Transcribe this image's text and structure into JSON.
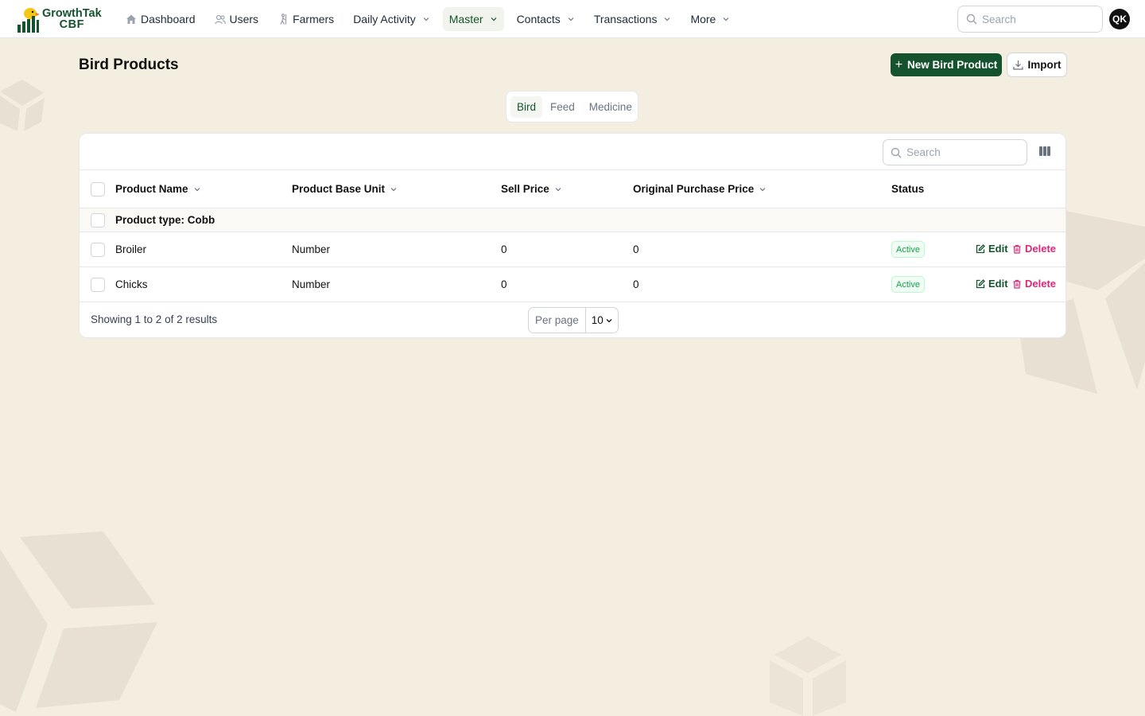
{
  "brand": {
    "name": "GrowthTak",
    "sub": "CBF"
  },
  "nav": {
    "items": [
      {
        "label": "Dashboard",
        "icon": "home-icon"
      },
      {
        "label": "Users",
        "icon": "users-icon"
      },
      {
        "label": "Farmers",
        "icon": "farmer-icon"
      },
      {
        "label": "Daily Activity",
        "dropdown": true
      },
      {
        "label": "Master",
        "dropdown": true,
        "active": true
      },
      {
        "label": "Contacts",
        "dropdown": true
      },
      {
        "label": "Transactions",
        "dropdown": true
      },
      {
        "label": "More",
        "dropdown": true
      }
    ],
    "search_placeholder": "Search",
    "avatar_initials": "QK"
  },
  "page": {
    "title": "Bird Products",
    "new_button": "New Bird Product",
    "import_button": "Import"
  },
  "tabs": [
    {
      "label": "Bird",
      "active": true
    },
    {
      "label": "Feed"
    },
    {
      "label": "Medicine"
    }
  ],
  "table": {
    "search_placeholder": "Search",
    "columns": [
      "Product Name",
      "Product Base Unit",
      "Sell Price",
      "Original Purchase Price",
      "Status"
    ],
    "group_label": "Product type: Cobb",
    "rows": [
      {
        "name": "Broiler",
        "unit": "Number",
        "sell_price": "0",
        "original_purchase_price": "0",
        "status": "Active"
      },
      {
        "name": "Chicks",
        "unit": "Number",
        "sell_price": "0",
        "original_purchase_price": "0",
        "status": "Active"
      }
    ],
    "actions": {
      "edit": "Edit",
      "delete": "Delete"
    },
    "footer": "Showing 1 to 2 of 2 results",
    "per_page_label": "Per page",
    "per_page_value": "10"
  },
  "colors": {
    "background": "#f4eee1",
    "primary": "#14532d",
    "active_badge": "#16a34a",
    "delete": "#db2777"
  }
}
